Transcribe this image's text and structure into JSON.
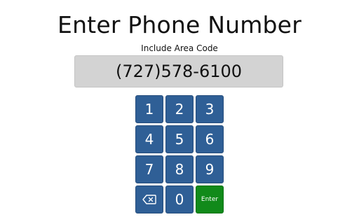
{
  "header": {
    "title": "Enter Phone Number",
    "subtitle": "Include Area Code"
  },
  "display": {
    "value": "(727)578-6100"
  },
  "keypad": {
    "keys": [
      "1",
      "2",
      "3",
      "4",
      "5",
      "6",
      "7",
      "8",
      "9"
    ],
    "zero": "0",
    "enter_label": "Enter",
    "backspace_icon": "backspace-icon"
  },
  "colors": {
    "key_blue": "#2f5f96",
    "enter_green": "#118a1a",
    "display_gray": "#d3d3d3"
  }
}
